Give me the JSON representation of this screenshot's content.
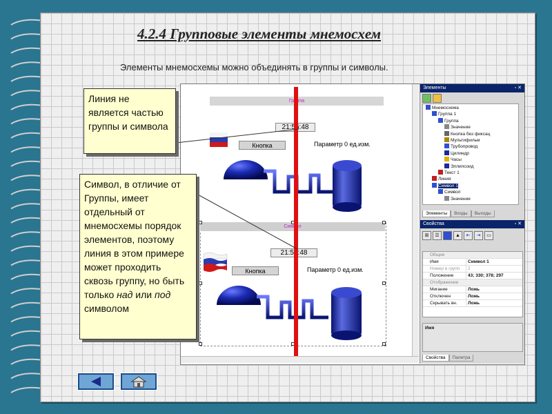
{
  "slide": {
    "title": "4.2.4 Групповые элементы мнемосхем",
    "subtitle": "Элементы мнемосхемы можно объединять в группы и символы."
  },
  "callouts": {
    "line_note": "Линия не является частью группы и символа",
    "symbol_note_part1": "Символ, в отличие от Группы, имеет отдельный от мнемосхемы порядок элементов, поэтому линия в этом примере может проходить сквозь группу, но быть только ",
    "symbol_note_over": "над",
    "symbol_note_or": " или ",
    "symbol_note_under": "под",
    "symbol_note_part2": " символом"
  },
  "canvas": {
    "group_label": "Группа",
    "symbol_label": "Символ",
    "group_time": "21:56:48",
    "group_button": "Кнопка",
    "group_param": "Параметр  0 ед.изм.",
    "symbol_time": "21:56:48",
    "symbol_button": "Кнопка",
    "symbol_param": "Параметр  0 ед.изм."
  },
  "elements_panel": {
    "title": "Элементы",
    "close": "▫ ✕",
    "tree": [
      {
        "label": "Мнемосхема",
        "depth": 0,
        "icon": "mnemo-icon"
      },
      {
        "label": "Группа 1",
        "depth": 1,
        "icon": "group-icon"
      },
      {
        "label": "Группа",
        "depth": 2,
        "icon": "group-icon"
      },
      {
        "label": "Значение",
        "depth": 3,
        "icon": "value-icon"
      },
      {
        "label": "Кнопка без фиксац",
        "depth": 3,
        "icon": "button-icon"
      },
      {
        "label": "Мультифильм",
        "depth": 3,
        "icon": "animation-icon"
      },
      {
        "label": "Трубопровод",
        "depth": 3,
        "icon": "pipe-icon"
      },
      {
        "label": "Цилиндр",
        "depth": 3,
        "icon": "cylinder-icon"
      },
      {
        "label": "Часы",
        "depth": 3,
        "icon": "clock-icon"
      },
      {
        "label": "Эллипсоид",
        "depth": 3,
        "icon": "ellipsoid-icon"
      },
      {
        "label": "Текст 1",
        "depth": 2,
        "icon": "text-icon"
      },
      {
        "label": "Линия",
        "depth": 1,
        "icon": "line-icon"
      },
      {
        "label": "Символ 1",
        "depth": 1,
        "icon": "symbol-icon",
        "selected": true
      },
      {
        "label": "Символ",
        "depth": 2,
        "icon": "symbol-icon"
      },
      {
        "label": "Значение",
        "depth": 3,
        "icon": "value-icon"
      }
    ],
    "tabs": [
      "Элементы",
      "Входы",
      "Выходы"
    ]
  },
  "properties_panel": {
    "title": "Свойства",
    "close": "▫ ✕",
    "rows": [
      {
        "key": "Общие",
        "value": "",
        "group": true
      },
      {
        "key": "Имя",
        "value": "Символ 1"
      },
      {
        "key": "Номер в групп",
        "value": "2",
        "muted": true
      },
      {
        "key": "Положение",
        "value": "43; 330; 378; 297"
      },
      {
        "key": "Отображение",
        "value": "",
        "group": true
      },
      {
        "key": "Мигание",
        "value": "Ложь"
      },
      {
        "key": "Отключен",
        "value": "Ложь"
      },
      {
        "key": "Скрывать вн.",
        "value": "Ложь"
      }
    ],
    "description_label": "Имя",
    "tabs": [
      "Свойства",
      "Палитра"
    ]
  },
  "colors": {
    "accent_blue": "#0a246a",
    "red_line": "#e01010",
    "tank_blue": "#1a2a9a",
    "callout_bg": "#ffffd0"
  }
}
